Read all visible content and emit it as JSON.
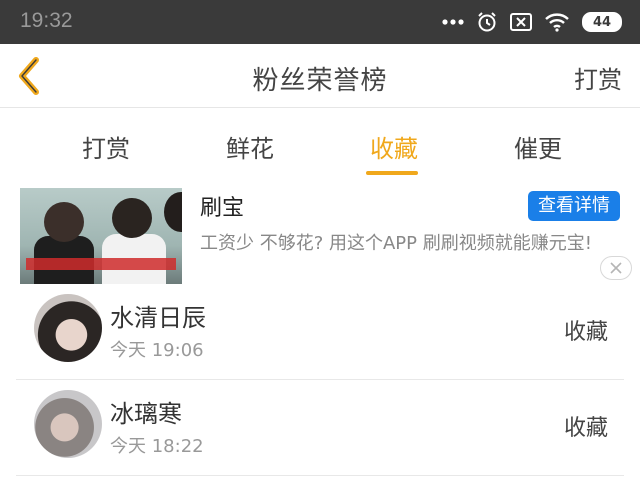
{
  "status_bar": {
    "time": "19:32",
    "battery": "44"
  },
  "header": {
    "title": "粉丝荣誉榜",
    "action": "打赏"
  },
  "tabs": [
    {
      "label": "打赏"
    },
    {
      "label": "鲜花"
    },
    {
      "label": "收藏"
    },
    {
      "label": "催更"
    }
  ],
  "active_tab": "收藏",
  "accent_color": "#f0a81c",
  "ad": {
    "title": "刷宝",
    "description": "工资少 不够花? 用这个APP 刷刷视频就能赚元宝!",
    "button": "查看详情"
  },
  "list": [
    {
      "name": "水清日辰",
      "time": "今天 19:06",
      "action": "收藏"
    },
    {
      "name": "冰璃寒",
      "time": "今天 18:22",
      "action": "收藏"
    }
  ]
}
